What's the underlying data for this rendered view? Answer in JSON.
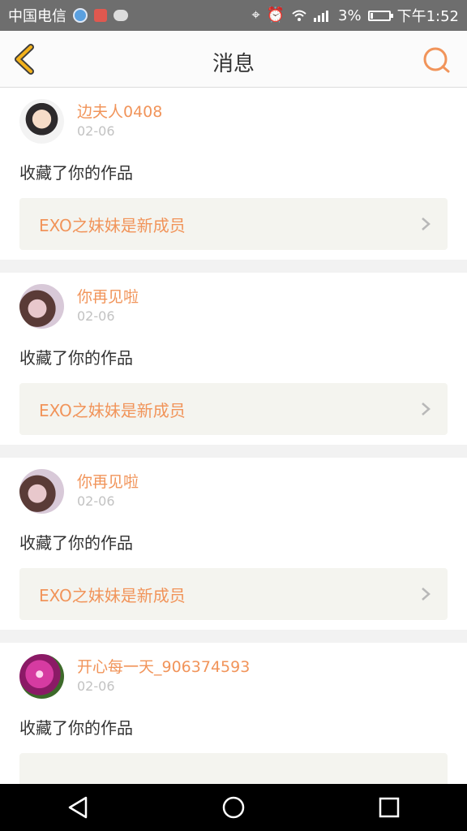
{
  "status_bar": {
    "carrier": "中国电信",
    "battery": "3%",
    "time": "下午1:52",
    "icons": [
      "location-icon",
      "alarm-icon",
      "wifi-icon",
      "signal-icon",
      "battery-icon"
    ]
  },
  "header": {
    "title": "消息",
    "back_icon": "chevron-left-icon",
    "search_icon": "search-icon"
  },
  "messages": [
    {
      "username": "边夫人0408",
      "date": "02-06",
      "action": "收藏了你的作品",
      "work_title": "EXO之妹妹是新成员",
      "avatar": "boy"
    },
    {
      "username": "你再见啦",
      "date": "02-06",
      "action": "收藏了你的作品",
      "work_title": "EXO之妹妹是新成员",
      "avatar": "girl"
    },
    {
      "username": "你再见啦",
      "date": "02-06",
      "action": "收藏了你的作品",
      "work_title": "EXO之妹妹是新成员",
      "avatar": "girl"
    },
    {
      "username": "开心每一天_906374593",
      "date": "02-06",
      "action": "收藏了你的作品",
      "work_title": "",
      "avatar": "flower"
    }
  ],
  "colors": {
    "accent": "#f1945a",
    "back_arrow": "#f3b21c",
    "status_bar": "#6e6e6e"
  }
}
